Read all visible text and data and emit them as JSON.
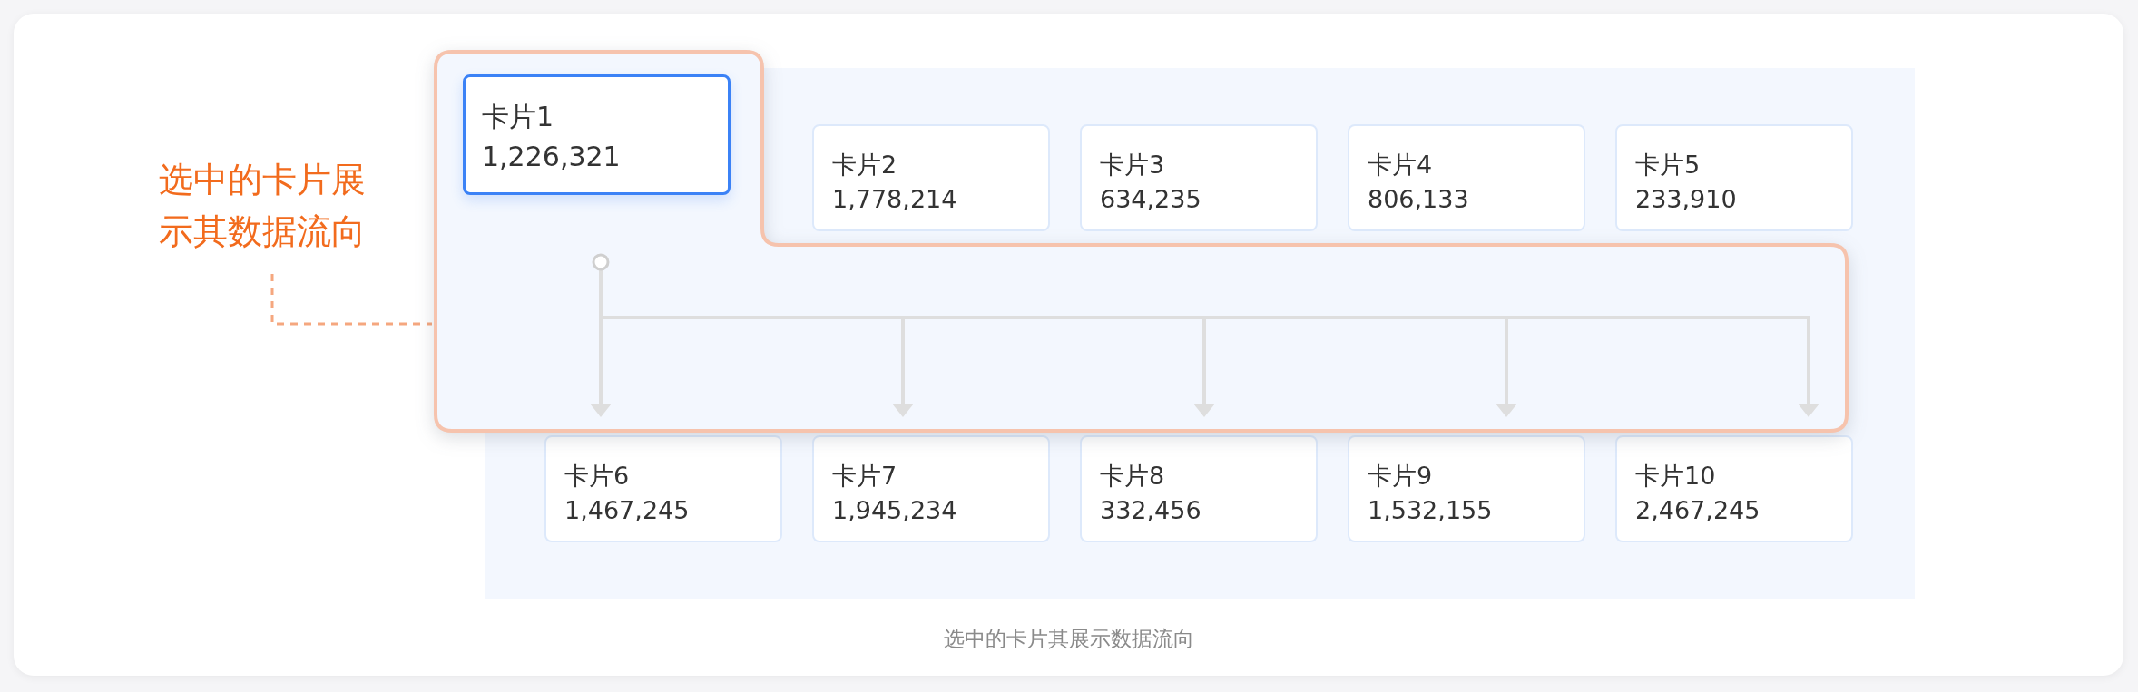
{
  "annotation": "选中的卡片展示其数据流向",
  "cards": [
    {
      "title": "卡片1",
      "value": "1,226,321",
      "selected": true
    },
    {
      "title": "卡片2",
      "value": "1,778,214",
      "selected": false
    },
    {
      "title": "卡片3",
      "value": "634,235",
      "selected": false
    },
    {
      "title": "卡片4",
      "value": "806,133",
      "selected": false
    },
    {
      "title": "卡片5",
      "value": "233,910",
      "selected": false
    },
    {
      "title": "卡片6",
      "value": "1,467,245",
      "selected": false
    },
    {
      "title": "卡片7",
      "value": "1,945,234",
      "selected": false
    },
    {
      "title": "卡片8",
      "value": "332,456",
      "selected": false
    },
    {
      "title": "卡片9",
      "value": "1,532,155",
      "selected": false
    },
    {
      "title": "卡片10",
      "value": "2,467,245",
      "selected": false
    }
  ],
  "caption": "选中的卡片其展示数据流向"
}
